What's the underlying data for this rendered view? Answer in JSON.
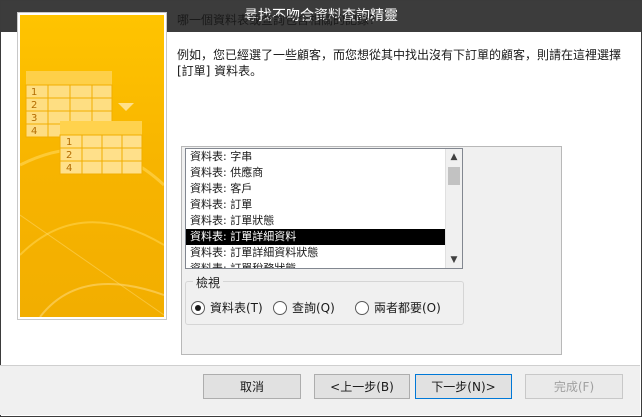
{
  "window": {
    "title": "尋找不吻合資料查詢精靈"
  },
  "prompt": "哪一個資料表或查詢包含相關的記錄?",
  "description": "例如，您已經選了一些顧客，而您想從其中找出沒有下訂單的顧客，則請在這裡選擇 [訂單] 資料表。",
  "art": {
    "numbers_back": [
      "1",
      "2",
      "3",
      "4"
    ],
    "numbers_front": [
      "1",
      "2",
      "4"
    ]
  },
  "listbox": {
    "items": [
      "資料表: 字串",
      "資料表: 供應商",
      "資料表: 客戶",
      "資料表: 訂單",
      "資料表: 訂單狀態",
      "資料表: 訂單詳細資料",
      "資料表: 訂單詳細資料狀態",
      "資料表: 訂單稅務狀態"
    ],
    "selected": "資料表: 訂單詳細資料"
  },
  "view": {
    "legend": "檢視",
    "options": [
      {
        "label": "資料表(T)",
        "checked": true
      },
      {
        "label": "查詢(Q)",
        "checked": false
      },
      {
        "label": "兩者都要(O)",
        "checked": false
      }
    ]
  },
  "buttons": {
    "cancel": "取消",
    "back": "<上一步(B)",
    "next": "下一步(N)>",
    "finish": "完成(F)"
  },
  "colors": {
    "art_orange": "#f5b800",
    "art_light": "#ffd966",
    "selection": "#000000",
    "title_bar": "#3c3c3c"
  }
}
